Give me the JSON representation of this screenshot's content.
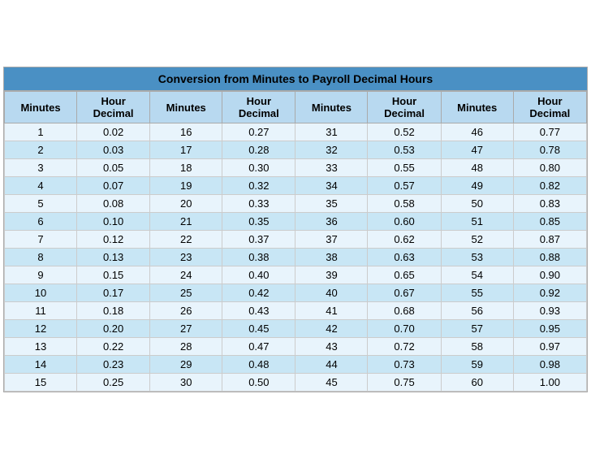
{
  "title": "Conversion from Minutes to Payroll Decimal Hours",
  "columns": [
    {
      "minutes": "Minutes",
      "decimal": "Hour\nDecimal"
    },
    {
      "minutes": "Minutes",
      "decimal": "Hour\nDecimal"
    },
    {
      "minutes": "Minutes",
      "decimal": "Hour\nDecimal"
    },
    {
      "minutes": "Minutes",
      "decimal": "Hour\nDecimal"
    }
  ],
  "rows": [
    [
      1,
      "0.02",
      16,
      "0.27",
      31,
      "0.52",
      46,
      "0.77"
    ],
    [
      2,
      "0.03",
      17,
      "0.28",
      32,
      "0.53",
      47,
      "0.78"
    ],
    [
      3,
      "0.05",
      18,
      "0.30",
      33,
      "0.55",
      48,
      "0.80"
    ],
    [
      4,
      "0.07",
      19,
      "0.32",
      34,
      "0.57",
      49,
      "0.82"
    ],
    [
      5,
      "0.08",
      20,
      "0.33",
      35,
      "0.58",
      50,
      "0.83"
    ],
    [
      6,
      "0.10",
      21,
      "0.35",
      36,
      "0.60",
      51,
      "0.85"
    ],
    [
      7,
      "0.12",
      22,
      "0.37",
      37,
      "0.62",
      52,
      "0.87"
    ],
    [
      8,
      "0.13",
      23,
      "0.38",
      38,
      "0.63",
      53,
      "0.88"
    ],
    [
      9,
      "0.15",
      24,
      "0.40",
      39,
      "0.65",
      54,
      "0.90"
    ],
    [
      10,
      "0.17",
      25,
      "0.42",
      40,
      "0.67",
      55,
      "0.92"
    ],
    [
      11,
      "0.18",
      26,
      "0.43",
      41,
      "0.68",
      56,
      "0.93"
    ],
    [
      12,
      "0.20",
      27,
      "0.45",
      42,
      "0.70",
      57,
      "0.95"
    ],
    [
      13,
      "0.22",
      28,
      "0.47",
      43,
      "0.72",
      58,
      "0.97"
    ],
    [
      14,
      "0.23",
      29,
      "0.48",
      44,
      "0.73",
      59,
      "0.98"
    ],
    [
      15,
      "0.25",
      30,
      "0.50",
      45,
      "0.75",
      60,
      "1.00"
    ]
  ]
}
